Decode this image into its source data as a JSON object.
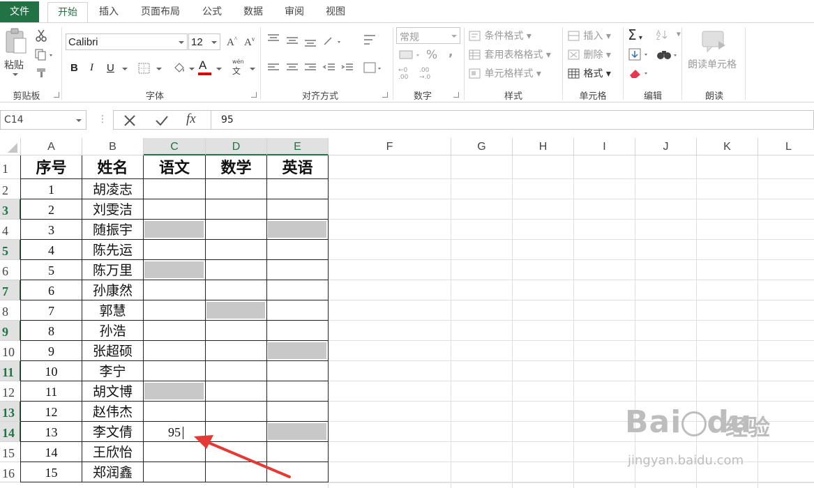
{
  "ribbon_tabs": [
    "文件",
    "开始",
    "插入",
    "页面布局",
    "公式",
    "数据",
    "审阅",
    "视图"
  ],
  "clipboard": {
    "paste_label": "粘贴",
    "group_label": "剪贴板"
  },
  "font": {
    "name": "Calibri",
    "size": "12",
    "bold": "B",
    "italic": "I",
    "underline": "U",
    "grow": "A",
    "shrink": "A",
    "font_color": "A",
    "phonetic": "wén",
    "group_label": "字体",
    "font_color_hex": "#e00000"
  },
  "alignment": {
    "group_label": "对齐方式"
  },
  "number": {
    "format": "常规",
    "percent": "%",
    "comma": ",",
    "inc_decimal_top": "←0",
    "inc_decimal_bottom": ".00",
    "dec_decimal_top": ".00",
    "dec_decimal_bottom": "→.0",
    "group_label": "数字"
  },
  "styles": {
    "conditional": "条件格式",
    "table_format": "套用表格格式",
    "cell_styles": "单元格样式",
    "group_label": "样式"
  },
  "cells": {
    "insert": "插入",
    "delete": "删除",
    "format": "格式",
    "group_label": "单元格"
  },
  "editing": {
    "sum": "Σ",
    "group_label": "编辑"
  },
  "read": {
    "button": "朗读单元格",
    "group_label": "朗读"
  },
  "formula_bar": {
    "name_box": "C14",
    "fx": "fx",
    "value": "95"
  },
  "columns": [
    "A",
    "B",
    "C",
    "D",
    "E",
    "F",
    "G",
    "H",
    "I",
    "J",
    "K",
    "L"
  ],
  "table": {
    "headers": [
      "序号",
      "姓名",
      "语文",
      "数学",
      "英语"
    ],
    "rows": [
      {
        "no": "1",
        "name": "胡凌志"
      },
      {
        "no": "2",
        "name": "刘雯洁"
      },
      {
        "no": "3",
        "name": "随振宇"
      },
      {
        "no": "4",
        "name": "陈先运"
      },
      {
        "no": "5",
        "name": "陈万里"
      },
      {
        "no": "6",
        "name": "孙康然"
      },
      {
        "no": "7",
        "name": "郭慧"
      },
      {
        "no": "8",
        "name": "孙浩"
      },
      {
        "no": "9",
        "name": "张超硕"
      },
      {
        "no": "10",
        "name": "李宁"
      },
      {
        "no": "11",
        "name": "胡文博"
      },
      {
        "no": "12",
        "name": "赵伟杰"
      },
      {
        "no": "13",
        "name": "李文倩"
      },
      {
        "no": "14",
        "name": "王欣怡"
      },
      {
        "no": "15",
        "name": "郑润鑫"
      }
    ],
    "row_numbers": [
      "1",
      "2",
      "3",
      "4",
      "5",
      "6",
      "7",
      "8",
      "9",
      "10",
      "11",
      "12",
      "13",
      "14",
      "15",
      "16"
    ],
    "editing_value": "95",
    "blank_fill_color": "#c8c8c8"
  },
  "watermark": {
    "brand": "Bai",
    "brand_suffix": "du",
    "cn": "经验",
    "url": "jingyan.baidu.com"
  },
  "colors": {
    "accent": "#217346",
    "arrow": "#e53935"
  }
}
